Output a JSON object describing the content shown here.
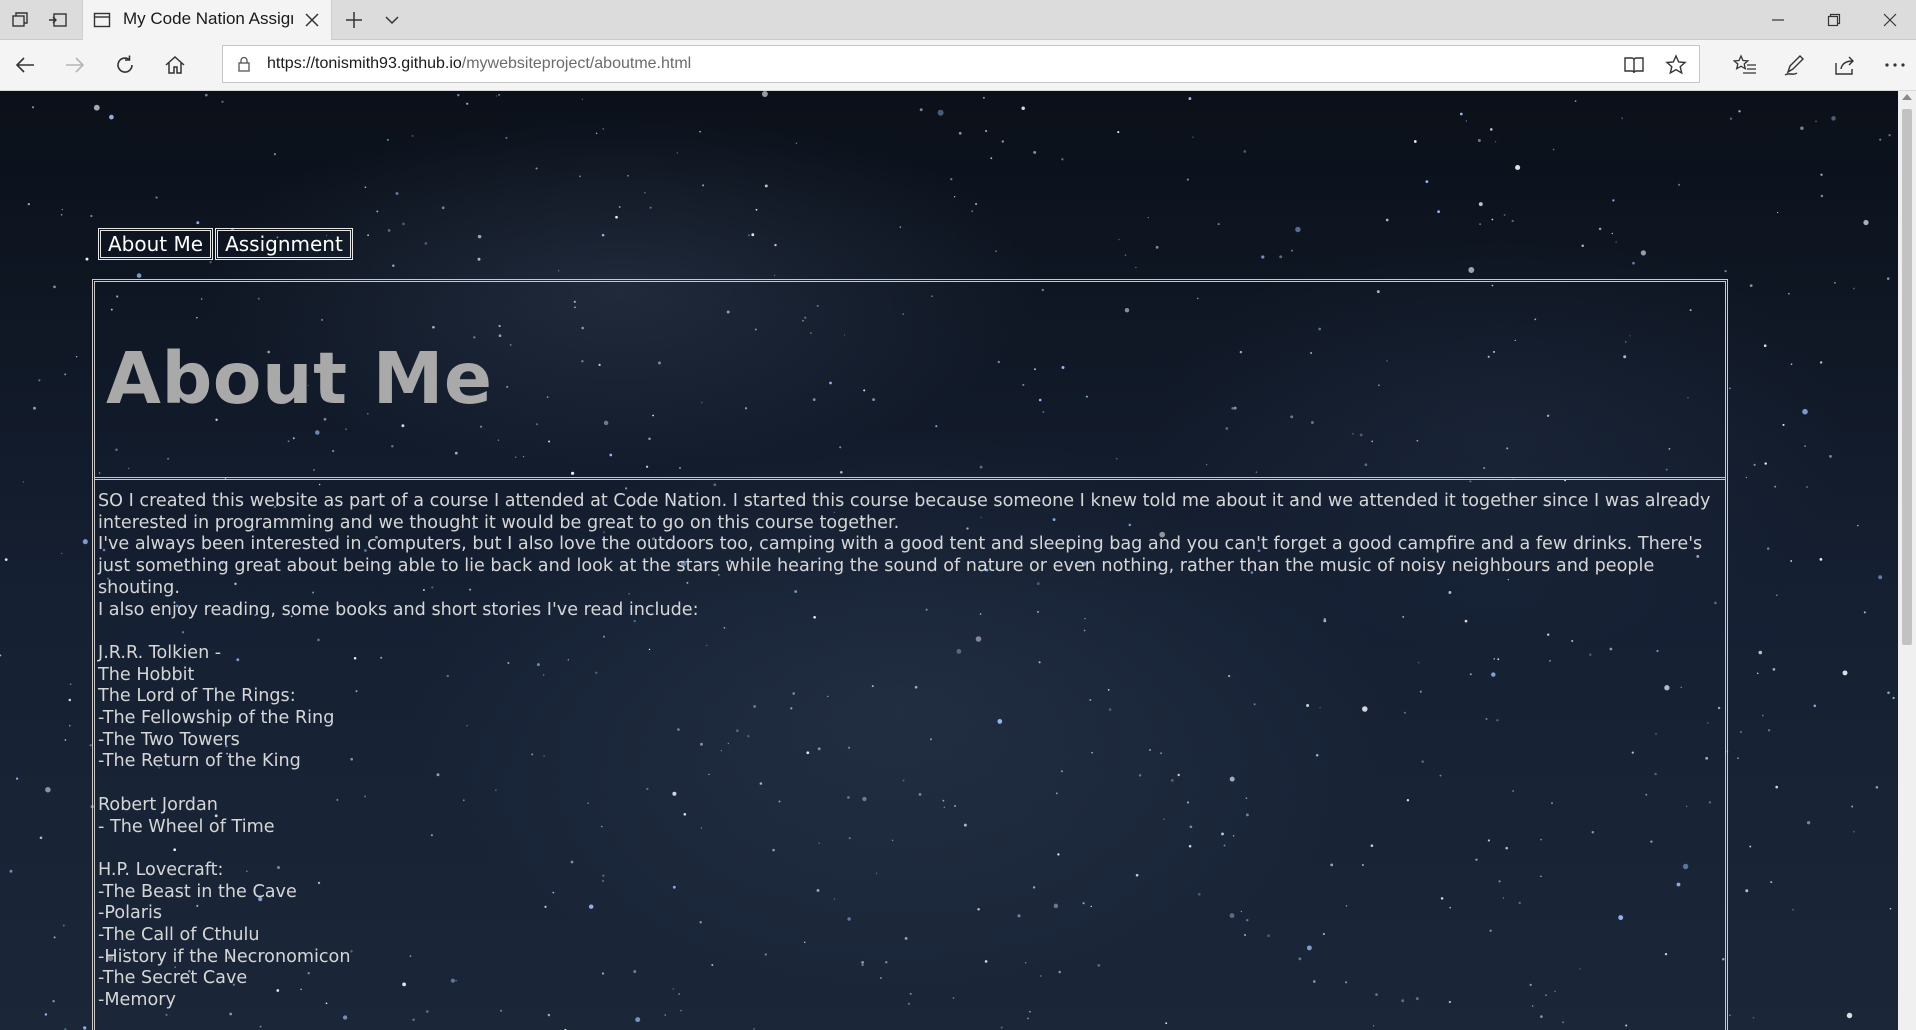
{
  "browser": {
    "tab_title": "My Code Nation Assign",
    "url_host": "https://tonismith93.github.io",
    "url_path": "/mywebsiteproject/aboutme.html",
    "icons": {
      "tab_actions": "tab-set-aside-icon",
      "tab_preview": "show-tabs-icon",
      "favicon": "page-icon",
      "close_tab": "close-icon",
      "new_tab": "plus-icon",
      "tab_list": "chevron-down-icon",
      "back": "back-arrow-icon",
      "forward": "forward-arrow-icon",
      "refresh": "refresh-icon",
      "home": "home-icon",
      "lock": "lock-icon",
      "reading_view": "reading-view-icon",
      "favorite": "star-icon",
      "favorites_hub": "favorites-list-icon",
      "web_note": "pen-icon",
      "share": "share-icon",
      "more": "more-icon"
    }
  },
  "site": {
    "nav": [
      {
        "label": "About Me"
      },
      {
        "label": "Assignment"
      }
    ],
    "heading": "About Me",
    "paragraphs": [
      "SO I created this website as part of a course I attended at Code Nation. I started this course because someone I knew told me about it and we attended it together since I was already interested in programming and we thought it would be great to go on this course together.",
      "I've always been interested in computers, but I also love the outdoors too, camping with a good tent and sleeping bag and you can't forget a good campfire and a few drinks. There's just something great about being able to lie back and look at the stars while hearing the sound of nature or even nothing, rather than the music of noisy neighbours and people shouting.",
      "I also enjoy reading, some books and short stories I've read include:"
    ],
    "books": {
      "tolkien": [
        "J.R.R. Tolkien -",
        "The Hobbit",
        "The Lord of The Rings:",
        "-The Fellowship of the Ring",
        "-The Two Towers",
        "-The Return of the King"
      ],
      "jordan": [
        "Robert Jordan",
        "- The Wheel of Time"
      ],
      "lovecraft": [
        "H.P. Lovecraft:",
        "-The Beast in the Cave",
        "-Polaris",
        "-The Call of Cthulu",
        "-History if the Necronomicon",
        "-The Secret Cave",
        "-Memory"
      ]
    }
  },
  "colors": {
    "heading": "#a9a9a9",
    "body_text": "#d6d6d6",
    "nav_text": "#ffffff",
    "border": "#c9c9c9"
  }
}
